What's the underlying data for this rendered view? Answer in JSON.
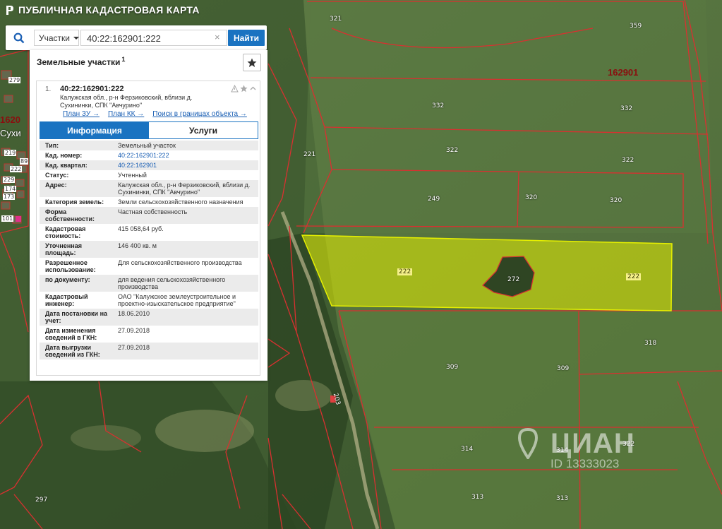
{
  "app": {
    "title": "ПУБЛИЧНАЯ КАДАСТРОВАЯ КАРТА"
  },
  "search": {
    "type_label": "Участки",
    "query": "40:22:162901:222",
    "submit_label": "Найти"
  },
  "panel": {
    "heading": "Земельные участки",
    "count": "1",
    "result": {
      "index": "1.",
      "cadastral_number": "40:22:162901:222",
      "address_short": "Калужская обл., р-н Ферзиковский, вблизи д. Сухининки, СПК \"Авчурино\"",
      "links": [
        "План ЗУ →",
        "План КК →",
        "Поиск в границах объекта →"
      ]
    },
    "tabs": [
      "Информация",
      "Услуги"
    ],
    "rows": [
      {
        "key": "Тип:",
        "value": "Земельный участок"
      },
      {
        "key": "Кад. номер:",
        "value": "40:22:162901:222"
      },
      {
        "key": "Кад. квартал:",
        "value": "40:22:162901"
      },
      {
        "key": "Статус:",
        "value": "Учтенный"
      },
      {
        "key": "Адрес:",
        "value": "Калужская обл., р-н Ферзиковский, вблизи д. Сухининки, СПК \"Авчурино\""
      },
      {
        "key": "Категория земель:",
        "value": "Земли сельскохозяйственного назначения"
      },
      {
        "key": "Форма собственности:",
        "value": "Частная собственность"
      },
      {
        "key": "Кадастровая стоимость:",
        "value": "415 058,64 руб."
      },
      {
        "key": "Уточненная площадь:",
        "value": "146 400 кв. м"
      },
      {
        "key": "Разрешенное использование:",
        "value": "Для сельскохозяйственного производства"
      },
      {
        "key": "по документу:",
        "value": "для ведения сельскохозяйственного производства"
      },
      {
        "key": "Кадастровый инженер:",
        "value": "ОАО \"Калужское землеустроительное и проектно-изыскательское предприятие\""
      },
      {
        "key": "Дата постановки на учет:",
        "value": "18.06.2010"
      },
      {
        "key": "Дата изменения сведений в ГКН:",
        "value": "27.09.2018"
      },
      {
        "key": "Дата выгрузки сведений из ГКН:",
        "value": "27.09.2018"
      }
    ]
  },
  "map": {
    "quarter_label": "162901",
    "left_quarter_label": "1620",
    "village_label": "Сухи",
    "parcel_labels": [
      "321",
      "359",
      "332",
      "332",
      "221",
      "322",
      "322",
      "249",
      "320",
      "320",
      "222",
      "272",
      "222",
      "318",
      "309",
      "309",
      "314",
      "314",
      "322",
      "313",
      "313",
      "297",
      "203"
    ],
    "house_labels": [
      "279",
      "219",
      "222",
      "229",
      "89",
      "173",
      "174",
      "101"
    ],
    "colors": {
      "highlight": "#e6f000",
      "boundary": "#d93030",
      "panel_accent": "#1a73c1"
    }
  },
  "watermark": {
    "brand": "ЦИАН",
    "id": "ID 13333023"
  }
}
